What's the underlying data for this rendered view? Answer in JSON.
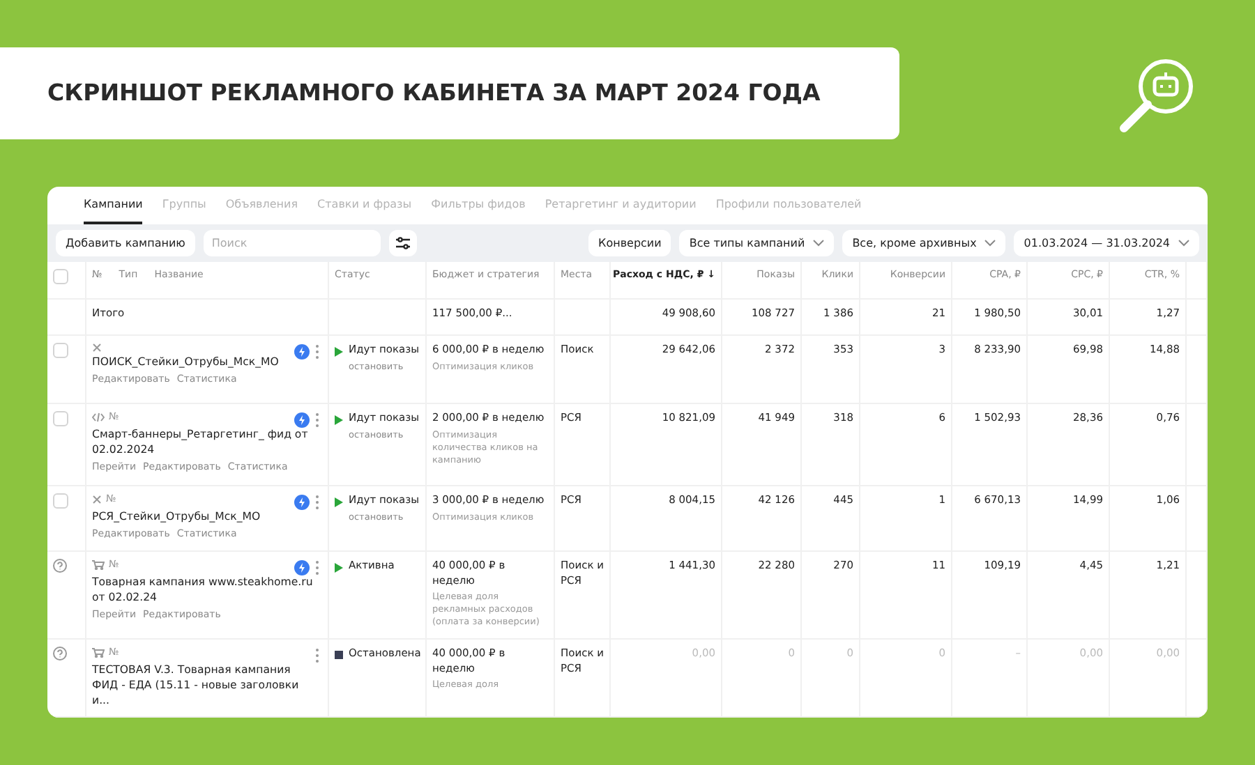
{
  "banner": {
    "title": "СКРИНШОТ РЕКЛАМНОГО КАБИНЕТА ЗА **МАРТ 2024 ГОДА**"
  },
  "tabs": [
    {
      "label": "Кампании",
      "selected": true
    },
    {
      "label": "Группы",
      "selected": false
    },
    {
      "label": "Объявления",
      "selected": false
    },
    {
      "label": "Ставки и фразы",
      "selected": false
    },
    {
      "label": "Фильтры фидов",
      "selected": false
    },
    {
      "label": "Ретаргетинг и аудитории",
      "selected": false
    },
    {
      "label": "Профили пользователей",
      "selected": false
    }
  ],
  "toolbar": {
    "add_button": "Добавить кампанию",
    "search": {
      "placeholder": "Поиск"
    },
    "conversions_button": "Конверсии",
    "dropdowns": [
      "Все типы кампаний",
      "Все, кроме архивных",
      "01.03.2024 — 31.03.2024"
    ]
  },
  "table": {
    "columns": {
      "select_all_checked": false,
      "number": "№",
      "type": "Тип",
      "name": "Название",
      "status": "Статус",
      "budget": "Бюджет и стратегия",
      "places": "Места",
      "metrics": [
        {
          "label": "Расход с НДС, ₽ ↓",
          "sorted": true
        },
        {
          "label": "Показы",
          "sorted": false
        },
        {
          "label": "Клики",
          "sorted": false
        },
        {
          "label": "Конверсии",
          "sorted": false
        },
        {
          "label": "CPA, ₽",
          "sorted": false
        },
        {
          "label": "CPC, ₽",
          "sorted": false
        },
        {
          "label": "CTR, %",
          "sorted": false
        }
      ]
    },
    "total": {
      "name": "Итого",
      "budget": "117 500,00 ₽...",
      "metrics": [
        "49 908,60",
        "108 727",
        "1 386",
        "21",
        "1 980,50",
        "30,01",
        "1,27"
      ]
    },
    "rows": [
      {
        "help": false,
        "checked": false,
        "kind": "text",
        "number_label": "",
        "boost": true,
        "name": "ПОИСК_Стейки_Отрубы_Мск_МО",
        "links": [
          "Редактировать",
          "Статистика"
        ],
        "status": {
          "kind": "running",
          "label": "Идут показы",
          "action": "остановить"
        },
        "budget": {
          "amount": "6 000,00 ₽ в неделю",
          "strategy": "Оптимизация кликов"
        },
        "places": "Поиск",
        "muted": false,
        "metrics": [
          "29 642,06",
          "2 372",
          "353",
          "3",
          "8 233,90",
          "69,98",
          "14,88"
        ]
      },
      {
        "help": false,
        "checked": false,
        "kind": "smart",
        "number_label": "№",
        "boost": true,
        "name": "Смарт-баннеры_Ретаргетинг_ фид от 02.02.2024",
        "links": [
          "Перейти",
          "Редактировать",
          "Статистика"
        ],
        "status": {
          "kind": "running",
          "label": "Идут показы",
          "action": "остановить"
        },
        "budget": {
          "amount": "2 000,00 ₽ в неделю",
          "strategy": "Оптимизация количества кликов на кампанию"
        },
        "places": "РСЯ",
        "muted": false,
        "metrics": [
          "10 821,09",
          "41 949",
          "318",
          "6",
          "1 502,93",
          "28,36",
          "0,76"
        ]
      },
      {
        "help": false,
        "checked": false,
        "kind": "text",
        "number_label": "№",
        "boost": true,
        "name": "РСЯ_Стейки_Отрубы_Мск_МО",
        "links": [
          "Редактировать",
          "Статистика"
        ],
        "status": {
          "kind": "running",
          "label": "Идут показы",
          "action": "остановить"
        },
        "budget": {
          "amount": "3 000,00 ₽ в неделю",
          "strategy": "Оптимизация кликов"
        },
        "places": "РСЯ",
        "muted": false,
        "metrics": [
          "8 004,15",
          "42 126",
          "445",
          "1",
          "6 670,13",
          "14,99",
          "1,06"
        ]
      },
      {
        "help": true,
        "kind": "product",
        "number_label": "№",
        "boost": true,
        "name": "Товарная кампания www.steakhome.ru от 02.02.24",
        "links": [
          "Перейти",
          "Редактировать"
        ],
        "status": {
          "kind": "running",
          "label": "Активна"
        },
        "budget": {
          "amount": "40 000,00 ₽ в неделю",
          "strategy": "Целевая доля рекламных расходов (оплата за конверсии)"
        },
        "places": "Поиск и РСЯ",
        "muted": false,
        "metrics": [
          "1 441,30",
          "22 280",
          "270",
          "11",
          "109,19",
          "4,45",
          "1,21"
        ]
      },
      {
        "help": true,
        "kind": "product",
        "number_label": "№",
        "boost": false,
        "name": "ТЕСТОВАЯ V.3. Товарная кампания ФИД - ЕДА (15.11 - новые заголовки и...",
        "links": [],
        "status": {
          "kind": "stopped",
          "label": "Остановлена"
        },
        "budget": {
          "amount": "40 000,00 ₽ в неделю",
          "strategy": "Целевая доля"
        },
        "places": "Поиск и РСЯ",
        "muted": true,
        "metrics": [
          "0,00",
          "0",
          "0",
          "0",
          "–",
          "0,00",
          "0,00"
        ]
      }
    ]
  }
}
